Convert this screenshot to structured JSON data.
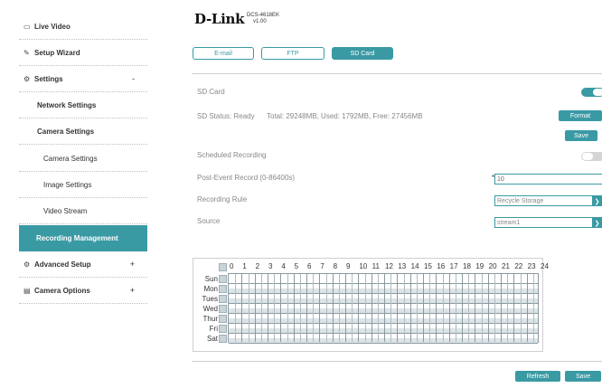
{
  "sidebar": {
    "live_video": "Live Video",
    "setup_wizard": "Setup Wizard",
    "settings": "Settings",
    "settings_sign": "-",
    "network_settings": "Network Settings",
    "camera_settings": "Camera Settings",
    "camera_settings_sub": "Camera Settings",
    "image_settings": "Image Settings",
    "video_stream": "Video Stream",
    "recording_management": "Recording Management",
    "advanced_setup": "Advanced Setup",
    "advanced_sign": "+",
    "camera_options": "Camera Options",
    "camera_options_sign": "+"
  },
  "header": {
    "brand": "D-Link",
    "model": "DCS-4618EK",
    "version": "v1.00"
  },
  "tabs": [
    {
      "label": "E-mail"
    },
    {
      "label": "FTP"
    },
    {
      "label": "SD Card"
    }
  ],
  "sd": {
    "sd_card_label": "SD Card",
    "status_label": "SD Status: Ready",
    "status_detail": "Total: 29248MB, Used: 1792MB, Free: 27456MB",
    "format_button": "Format",
    "save_button": "Save",
    "scheduled_label": "Scheduled Recording",
    "post_event_label": "Post-Event Record (0-86400s)",
    "post_event_required": "*",
    "post_event_value": "10",
    "recording_rule_label": "Recording Rule",
    "recording_rule_value": "Recycle Storage",
    "source_label": "Source",
    "source_value": "stream1",
    "sd_card_enabled": true,
    "scheduled_enabled": false
  },
  "schedule": {
    "days": [
      "Sun",
      "Mon",
      "Tues",
      "Wed",
      "Thur",
      "Fri",
      "Sat"
    ],
    "hours": [
      "0",
      "1",
      "2",
      "3",
      "4",
      "5",
      "6",
      "7",
      "8",
      "9",
      "10",
      "11",
      "12",
      "13",
      "14",
      "15",
      "16",
      "17",
      "18",
      "19",
      "20",
      "21",
      "22",
      "23",
      "24"
    ]
  },
  "footer": {
    "refresh_button": "Refresh",
    "save_button": "Save"
  },
  "colors": {
    "accent": "#3a9aa4",
    "divider": "#cfcfcf"
  }
}
